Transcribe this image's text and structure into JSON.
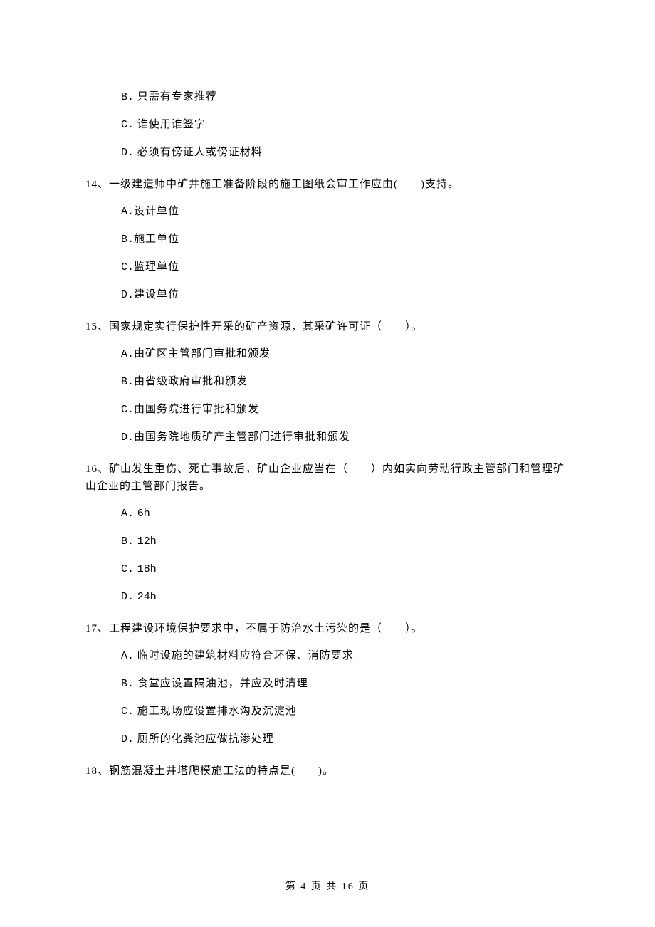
{
  "prev_options": {
    "b": {
      "marker": "B.",
      "text": "只需有专家推荐"
    },
    "c": {
      "marker": "C.",
      "text": "谁使用谁签字"
    },
    "d": {
      "marker": "D.",
      "text": "必须有傍证人或傍证材料"
    }
  },
  "q14": {
    "text": "14、一级建造师中矿井施工准备阶段的施工图纸会审工作应由(　　)支持。",
    "a": {
      "marker": "A.",
      "text": "设计单位"
    },
    "b": {
      "marker": "B.",
      "text": "施工单位"
    },
    "c": {
      "marker": "C.",
      "text": "监理单位"
    },
    "d": {
      "marker": "D.",
      "text": "建设单位"
    }
  },
  "q15": {
    "text": "15、国家规定实行保护性开采的矿产资源，其采矿许可证（　　）。",
    "a": {
      "marker": "A.",
      "text": "由矿区主管部门审批和颁发"
    },
    "b": {
      "marker": "B.",
      "text": "由省级政府审批和颁发"
    },
    "c": {
      "marker": "C.",
      "text": "由国务院进行审批和颁发"
    },
    "d": {
      "marker": "D.",
      "text": "由国务院地质矿产主管部门进行审批和颁发"
    }
  },
  "q16": {
    "text": "16、矿山发生重伤、死亡事故后，矿山企业应当在（　　）内如实向劳动行政主管部门和管理矿山企业的主管部门报告。",
    "a": {
      "marker": "A.",
      "text": "6h"
    },
    "b": {
      "marker": "B.",
      "text": "12h"
    },
    "c": {
      "marker": "C.",
      "text": "18h"
    },
    "d": {
      "marker": "D.",
      "text": "24h"
    }
  },
  "q17": {
    "text": "17、工程建设环境保护要求中，不属于防治水土污染的是（　　）。",
    "a": {
      "marker": "A.",
      "text": "临时设施的建筑材料应符合环保、消防要求"
    },
    "b": {
      "marker": "B.",
      "text": "食堂应设置隔油池，并应及时清理"
    },
    "c": {
      "marker": "C.",
      "text": "施工现场应设置排水沟及沉淀池"
    },
    "d": {
      "marker": "D.",
      "text": "厕所的化粪池应做抗渗处理"
    }
  },
  "q18": {
    "text": "18、钢筋混凝土井塔爬模施工法的特点是(　　)。"
  },
  "footer": "第 4 页 共 16 页"
}
